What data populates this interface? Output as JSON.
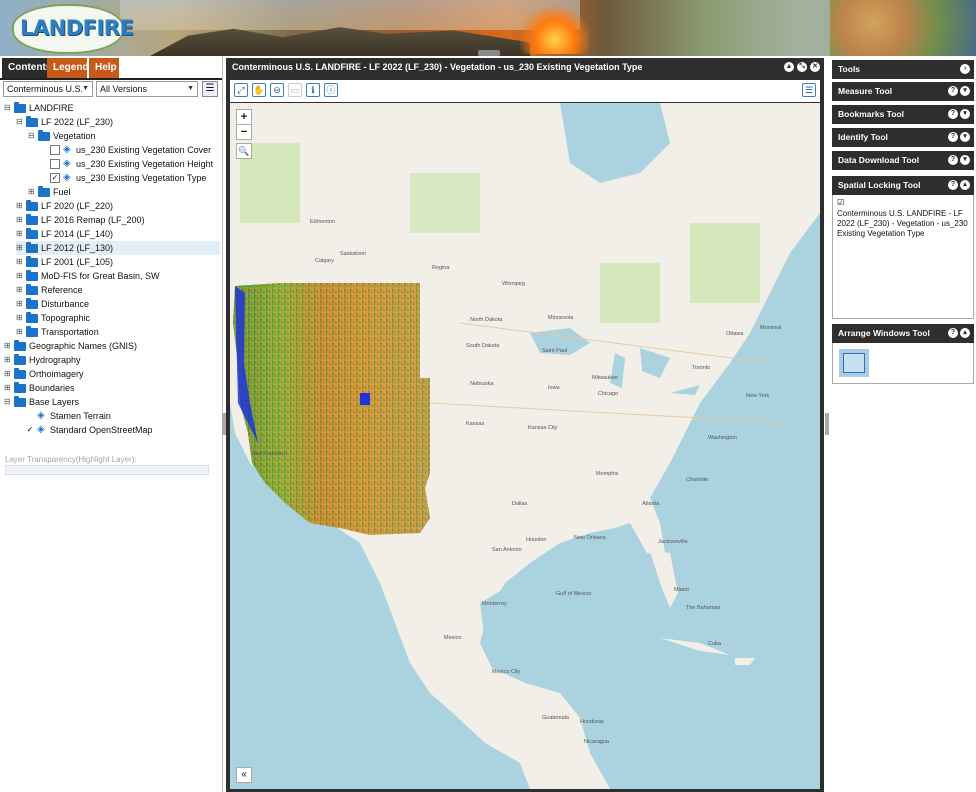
{
  "app": {
    "logo_text": "LANDFIRE"
  },
  "left_panel": {
    "tabs": [
      "Contents",
      "Legend",
      "Help"
    ],
    "region_select": "Conterminous U.S.",
    "version_select": "All Versions",
    "tree": {
      "root": "LANDFIRE",
      "lf2022": "LF 2022 (LF_230)",
      "vegetation": "Vegetation",
      "veg_cover": "us_230 Existing Vegetation Cover",
      "veg_height": "us_230 Existing Vegetation Height",
      "veg_type": "us_230 Existing Vegetation Type",
      "fuel": "Fuel",
      "lf2020": "LF 2020 (LF_220)",
      "lf2016": "LF 2016 Remap (LF_200)",
      "lf2014": "LF 2014 (LF_140)",
      "lf2012": "LF 2012 (LF_130)",
      "lf2001": "LF 2001 (LF_105)",
      "modfis": "MoD-FIS for Great Basin, SW",
      "reference": "Reference",
      "disturbance": "Disturbance",
      "topographic": "Topographic",
      "transportation": "Transportation",
      "gnis": "Geographic Names (GNIS)",
      "hydrography": "Hydrography",
      "orthoimagery": "Orthoimagery",
      "boundaries": "Boundaries",
      "base_layers": "Base Layers",
      "stamen": "Stamen Terrain",
      "osm": "Standard OpenStreetMap"
    },
    "transparency_label": "Layer Transparency(Highlight Layer):"
  },
  "map_window": {
    "title": "Conterminous U.S. LANDFIRE - LF 2022 (LF_230) - Vegetation - us_230 Existing Vegetation Type",
    "zoom_in": "+",
    "zoom_out": "−",
    "collapse": "«",
    "labels": {
      "edmonton": "Edmonton",
      "calgary": "Calgary",
      "regina": "Regina",
      "winnipeg": "Winnipeg",
      "saskatoon": "Saskatoon",
      "north_dakota": "North Dakota",
      "south_dakota": "South Dakota",
      "nebraska": "Nebraska",
      "kansas": "Kansas",
      "minnesota": "Minnesota",
      "iowa": "Iowa",
      "saint_paul": "Saint Paul",
      "milwaukee": "Milwaukee",
      "chicago": "Chicago",
      "toronto": "Toronto",
      "ottawa": "Ottawa",
      "montreal": "Montreal",
      "new_york": "New York",
      "washington": "Washington",
      "kansas_city": "Kansas City",
      "memphis": "Memphis",
      "atlanta": "Atlanta",
      "charlotte": "Charlotte",
      "dallas": "Dallas",
      "houston": "Houston",
      "san_antonio": "San Antonio",
      "new_orleans": "New Orleans",
      "jacksonville": "Jacksonville",
      "miami": "Miami",
      "the_bahamas": "The Bahamas",
      "cuba": "Cuba",
      "monterrey": "Monterrey",
      "mexico": "Mexico",
      "mexico_city": "Mexico City",
      "guatemala": "Guatemala",
      "honduras": "Honduras",
      "nicaragua": "Nicaragua",
      "san_francisco": "San Francisco",
      "gulf_of_mexico": "Gulf of Mexico"
    }
  },
  "right_panel": {
    "title": "Tools",
    "tools": [
      "Measure Tool",
      "Bookmarks Tool",
      "Identify Tool",
      "Data Download Tool"
    ],
    "spatial_locking": {
      "title": "Spatial Locking Tool",
      "text": "Conterminous U.S. LANDFIRE - LF 2022 (LF_230) - Vegetation - us_230 Existing Vegetation Type"
    },
    "arrange_windows": "Arrange Windows Tool"
  },
  "colors": {
    "tab_active": "#2b2b2b",
    "tab_orange": "#c85a19",
    "header_dark": "#2e2e2e",
    "folder_blue": "#1a73c9"
  }
}
